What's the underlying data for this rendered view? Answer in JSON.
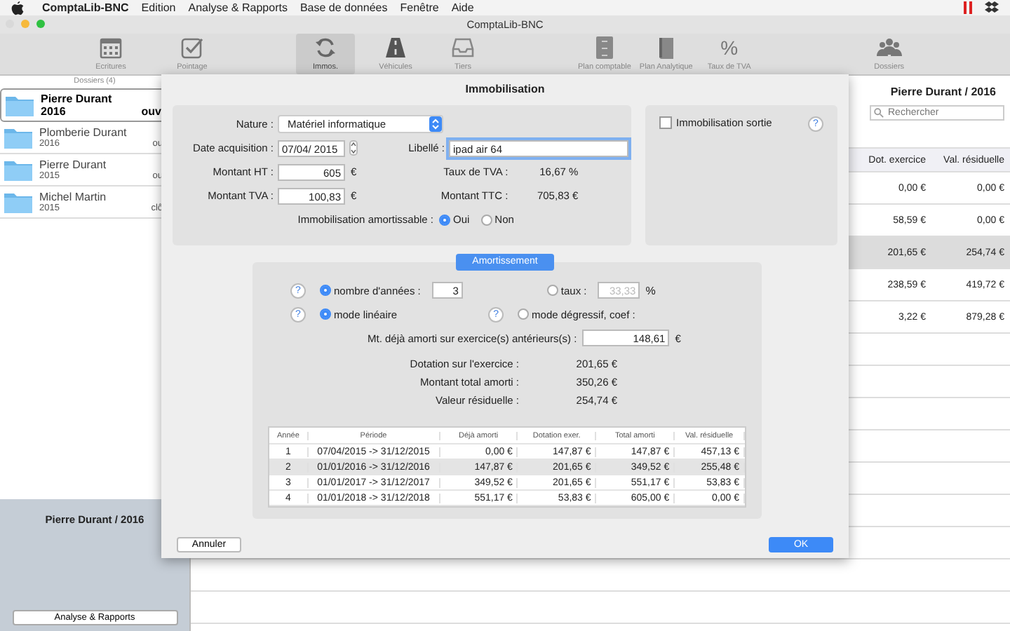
{
  "menu_bar": {
    "app": "ComptaLib-BNC",
    "items": [
      "Edition",
      "Analyse & Rapports",
      "Base de données",
      "Fenêtre",
      "Aide"
    ]
  },
  "window": {
    "title": "ComptaLib-BNC"
  },
  "toolbar": [
    {
      "label": "Ecritures",
      "kind": "calendar",
      "selected": false
    },
    {
      "label": "Pointage",
      "kind": "check",
      "selected": false
    },
    {
      "label": "Immos.",
      "kind": "sync",
      "selected": true
    },
    {
      "label": "Véhicules",
      "kind": "road",
      "selected": false
    },
    {
      "label": "Tiers",
      "kind": "tray",
      "selected": false
    },
    {
      "label": "Plan comptable",
      "kind": "cabinet",
      "selected": false
    },
    {
      "label": "Plan Analytique",
      "kind": "book",
      "selected": false
    },
    {
      "label": "Taux de TVA",
      "kind": "glyph",
      "glyph": "%",
      "selected": false
    },
    {
      "label": "Dossiers",
      "kind": "people",
      "selected": false
    }
  ],
  "sidebar": {
    "header": "Dossiers (4)",
    "items": [
      {
        "name": "Pierre Durant",
        "year": "2016",
        "status": "ouv",
        "selected": true
      },
      {
        "name": "Plomberie Durant",
        "year": "2016",
        "status": "ou",
        "selected": false
      },
      {
        "name": "Pierre Durant",
        "year": "2015",
        "status": "ou",
        "selected": false
      },
      {
        "name": "Michel Martin",
        "year": "2015",
        "status": "clô",
        "selected": false
      }
    ],
    "footer": {
      "title": "Pierre Durant / 2016",
      "button": "Analyse & Rapports"
    }
  },
  "main": {
    "title": "Pierre Durant / 2016",
    "search": {
      "placeholder": "Rechercher"
    },
    "columns": [
      "Dot. exercice",
      "Val. résiduelle"
    ],
    "rows": [
      {
        "cells": [
          "0,00 €",
          "0,00 €"
        ],
        "selected": false
      },
      {
        "cells": [
          "58,59 €",
          "0,00 €"
        ],
        "selected": false
      },
      {
        "cells": [
          "201,65 €",
          "254,74 €"
        ],
        "selected": true
      },
      {
        "cells": [
          "238,59 €",
          "419,72 €"
        ],
        "selected": false
      },
      {
        "cells": [
          "3,22 €",
          "879,28 €"
        ],
        "selected": false
      }
    ]
  },
  "dialog": {
    "title": "Immobilisation",
    "nature": {
      "label": "Nature :",
      "value": "Matériel informatique"
    },
    "date": {
      "label": "Date acquisition :",
      "value": "07/04/ 2015"
    },
    "libelle": {
      "label": "Libellé :",
      "value": "ipad air 64",
      "focused": true
    },
    "montant_ht": {
      "label": "Montant HT :",
      "value": "605",
      "unit": "€"
    },
    "taux_tva": {
      "label": "Taux de TVA :",
      "value": "16,67 %"
    },
    "montant_tva": {
      "label": "Montant TVA :",
      "value": "100,83",
      "unit": "€"
    },
    "montant_ttc": {
      "label": "Montant TTC :",
      "value": "705,83 €"
    },
    "amortissable": {
      "label": "Immobilisation amortissable :",
      "options": [
        {
          "label": "Oui",
          "selected": true
        },
        {
          "label": "Non",
          "selected": false
        }
      ]
    },
    "sortie": {
      "label": "Immobilisation sortie",
      "checked": false,
      "help": "?"
    },
    "amortissement": {
      "title": "Amortissement",
      "duree": {
        "help": "?",
        "label": "nombre d'années :",
        "value": "3",
        "selected": true
      },
      "taux": {
        "label": "taux :",
        "value": "33,33",
        "unit": "%",
        "selected": false,
        "disabled": true
      },
      "lineaire": {
        "help": "?",
        "label": "mode linéaire",
        "selected": true
      },
      "degressif": {
        "help": "?",
        "label": "mode dégressif, coef :",
        "selected": false
      },
      "deja": {
        "label": "Mt. déjà amorti sur exercice(s) antérieurs(s) :",
        "value": "148,61",
        "unit": "€"
      },
      "summary": [
        {
          "label": "Dotation sur l'exercice :",
          "value": "201,65 €"
        },
        {
          "label": "Montant total amorti :",
          "value": "350,26 €"
        },
        {
          "label": "Valeur résiduelle :",
          "value": "254,74 €"
        }
      ],
      "table": {
        "columns": [
          "Année",
          "Période",
          "Déjà amorti",
          "Dotation exer.",
          "Total amorti",
          "Val. résiduelle"
        ],
        "rows": [
          {
            "cells": [
              "1",
              "07/04/2015 -> 31/12/2015",
              "0,00 €",
              "147,87 €",
              "147,87 €",
              "457,13 €"
            ],
            "selected": false
          },
          {
            "cells": [
              "2",
              "01/01/2016 -> 31/12/2016",
              "147,87 €",
              "201,65 €",
              "349,52 €",
              "255,48 €"
            ],
            "selected": true
          },
          {
            "cells": [
              "3",
              "01/01/2017 -> 31/12/2017",
              "349,52 €",
              "201,65 €",
              "551,17 €",
              "53,83 €"
            ],
            "selected": false
          },
          {
            "cells": [
              "4",
              "01/01/2018 -> 31/12/2018",
              "551,17 €",
              "53,83 €",
              "605,00 €",
              "0,00 €"
            ],
            "selected": false
          }
        ]
      }
    },
    "cancel": "Annuler",
    "ok": "OK"
  }
}
